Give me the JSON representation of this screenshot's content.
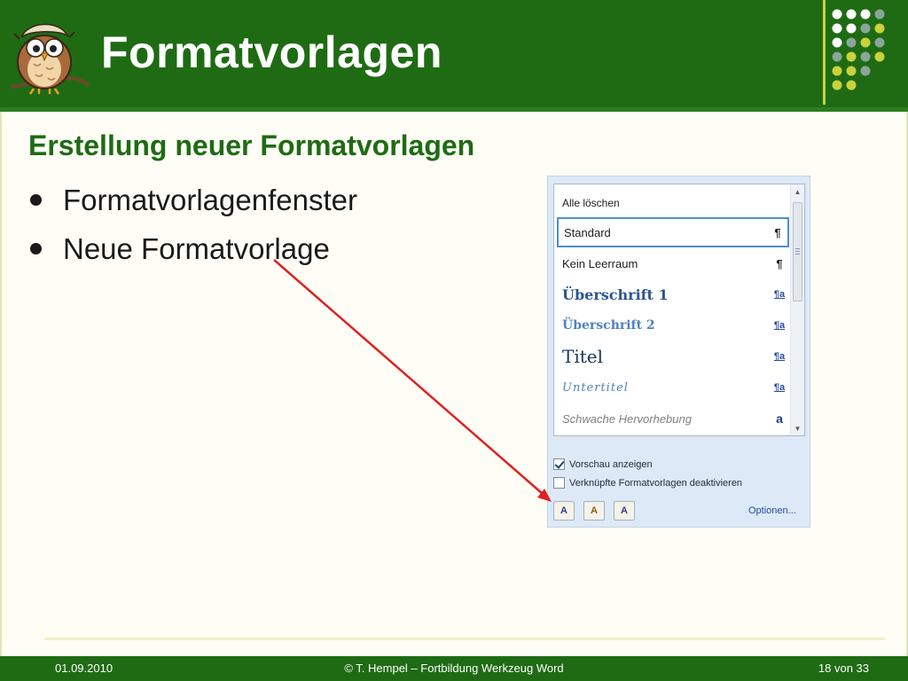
{
  "slide": {
    "title": "Formatvorlagen",
    "subheading": "Erstellung neuer Formatvorlagen",
    "bullets": [
      "Formatvorlagenfenster",
      "Neue Formatvorlage"
    ]
  },
  "styles_pane": {
    "styles": [
      {
        "label": "Alle löschen",
        "mark": ""
      },
      {
        "label": "Standard",
        "mark": "¶",
        "selected": true
      },
      {
        "label": "Kein Leerraum",
        "mark": "¶"
      },
      {
        "label": "Überschrift 1",
        "mark": "¶a"
      },
      {
        "label": "Überschrift 2",
        "mark": "¶a"
      },
      {
        "label": "Titel",
        "mark": "¶a"
      },
      {
        "label": "Untertitel",
        "mark": "¶a"
      },
      {
        "label": "Schwache Hervorhebung",
        "mark": "a"
      }
    ],
    "show_preview_label": "Vorschau anzeigen",
    "show_preview_checked": true,
    "disable_linked_label": "Verknüpfte Formatvorlagen deaktivieren",
    "disable_linked_checked": false,
    "new_style_icon": "A",
    "inspector_icon": "A",
    "manage_styles_icon": "A",
    "options_label": "Optionen..."
  },
  "footer": {
    "date": "01.09.2010",
    "center": "© T. Hempel – Fortbildung Werkzeug Word",
    "page": "18 von 33"
  },
  "colors": {
    "header_green": "#1f6b14",
    "accent_yellow": "#c9d23a",
    "arrow_red": "#e02020"
  }
}
